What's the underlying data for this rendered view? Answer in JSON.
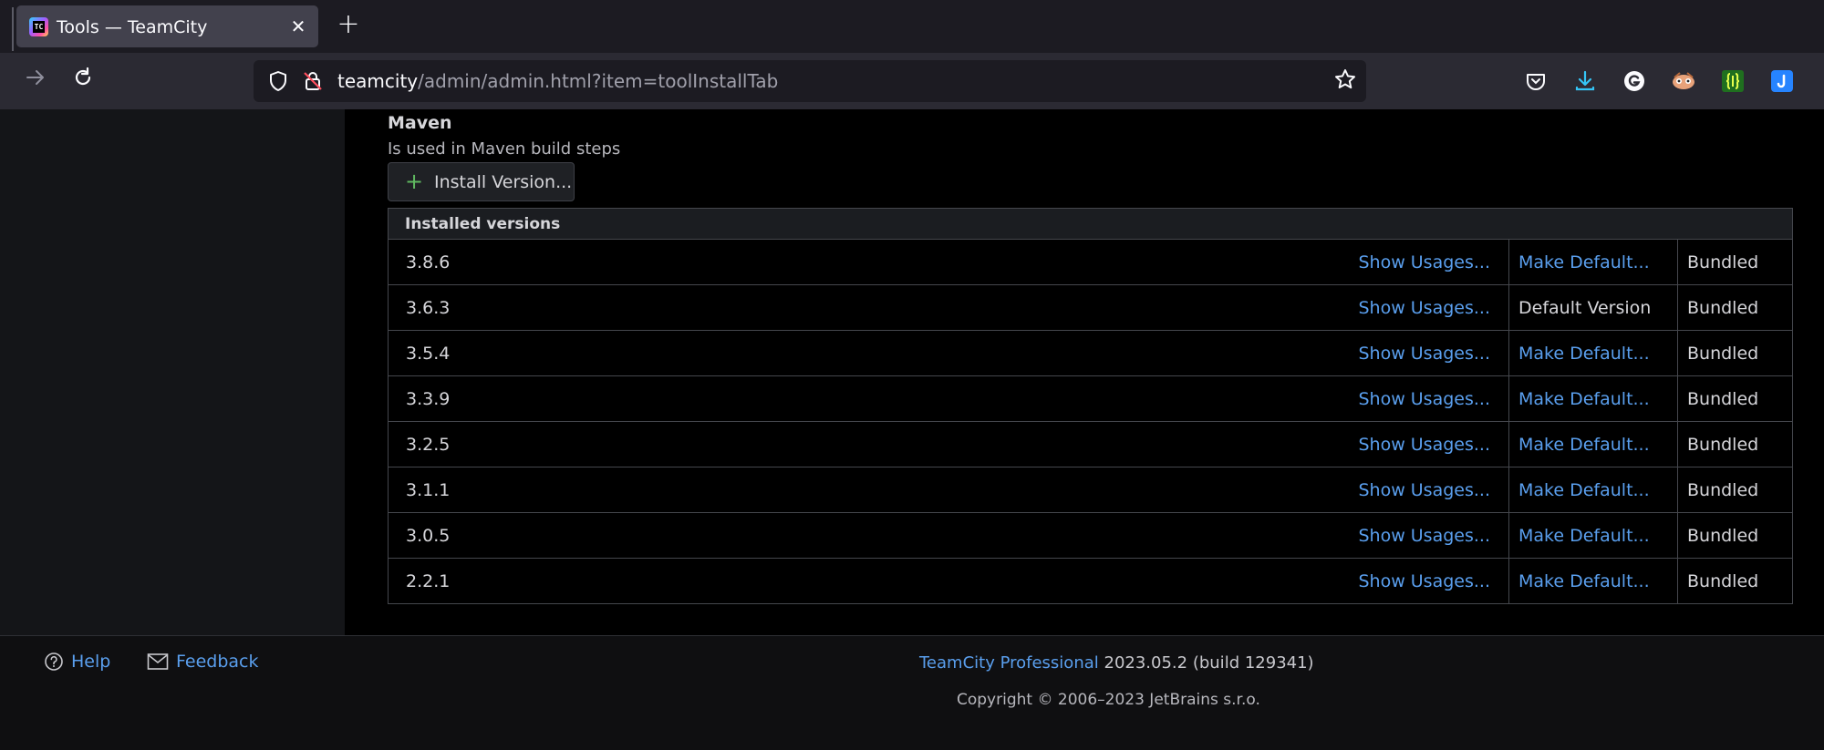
{
  "browser": {
    "tab_title": "Tools — TeamCity",
    "tab_logo_text": "TC",
    "url_host": "teamcity",
    "url_path": "/admin/admin.html?item=toolInstallTab"
  },
  "tool": {
    "name": "Maven",
    "description": "Is used in Maven build steps",
    "install_label": "Install Version..."
  },
  "table": {
    "header": "Installed versions",
    "rows": [
      {
        "version": "3.8.6",
        "usages": "Show Usages...",
        "default": "Make Default...",
        "default_is_link": true,
        "source": "Bundled"
      },
      {
        "version": "3.6.3",
        "usages": "Show Usages...",
        "default": "Default Version",
        "default_is_link": false,
        "source": "Bundled"
      },
      {
        "version": "3.5.4",
        "usages": "Show Usages...",
        "default": "Make Default...",
        "default_is_link": true,
        "source": "Bundled"
      },
      {
        "version": "3.3.9",
        "usages": "Show Usages...",
        "default": "Make Default...",
        "default_is_link": true,
        "source": "Bundled"
      },
      {
        "version": "3.2.5",
        "usages": "Show Usages...",
        "default": "Make Default...",
        "default_is_link": true,
        "source": "Bundled"
      },
      {
        "version": "3.1.1",
        "usages": "Show Usages...",
        "default": "Make Default...",
        "default_is_link": true,
        "source": "Bundled"
      },
      {
        "version": "3.0.5",
        "usages": "Show Usages...",
        "default": "Make Default...",
        "default_is_link": true,
        "source": "Bundled"
      },
      {
        "version": "2.2.1",
        "usages": "Show Usages...",
        "default": "Make Default...",
        "default_is_link": true,
        "source": "Bundled"
      }
    ]
  },
  "footer": {
    "help": "Help",
    "feedback": "Feedback",
    "product_link": "TeamCity Professional",
    "version": "2023.05.2 (build 129341)",
    "copyright": "Copyright © 2006–2023 JetBrains s.r.o."
  },
  "colors": {
    "link": "#5a9fee",
    "accent_plus": "#5fb760",
    "page_bg": "#000000"
  }
}
